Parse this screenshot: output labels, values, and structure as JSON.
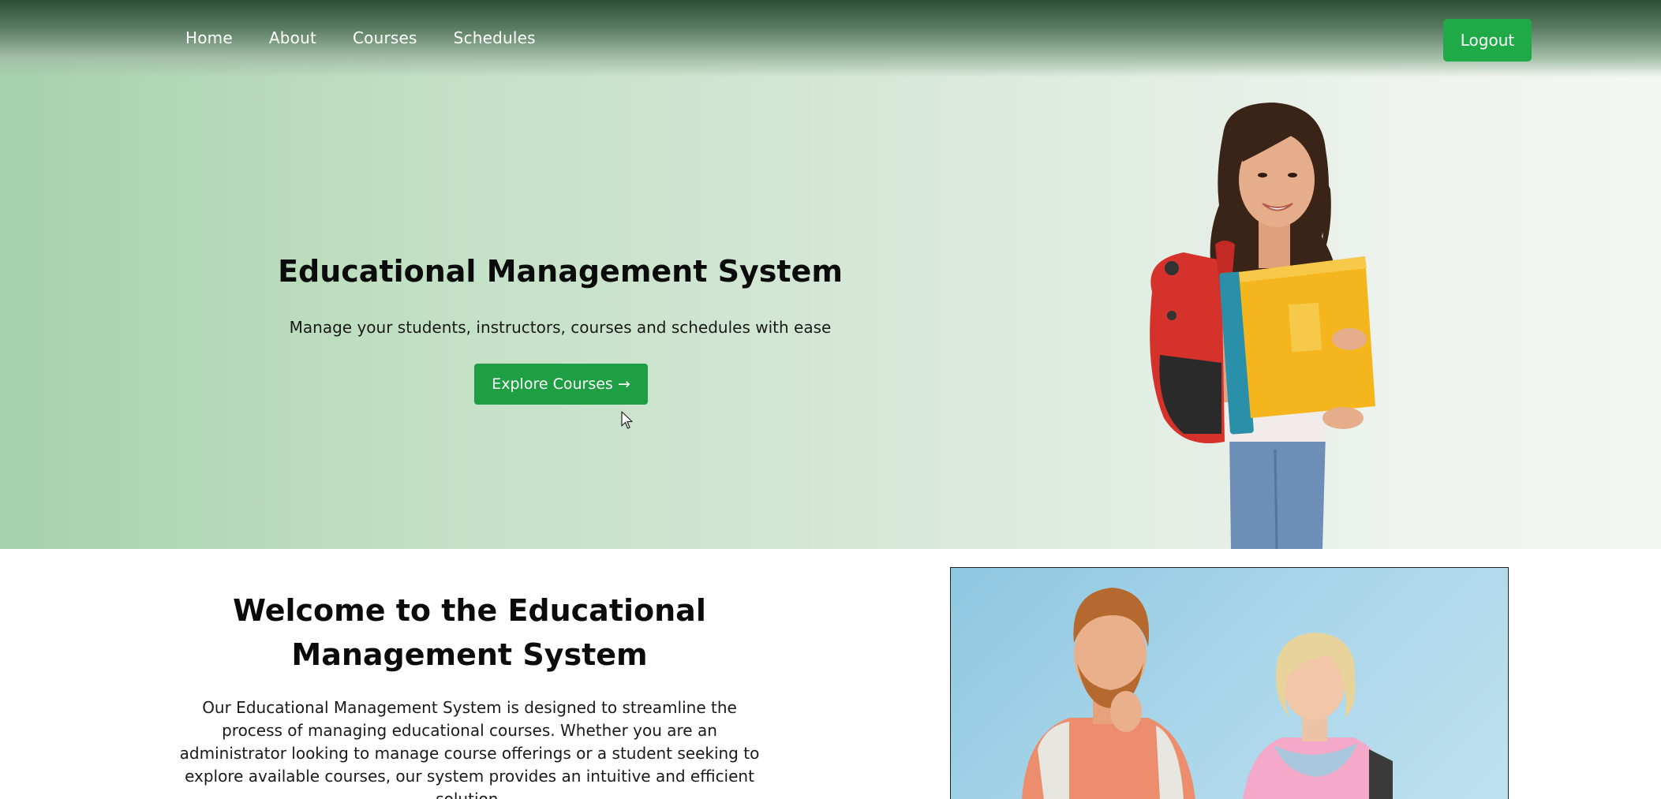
{
  "nav": {
    "links": [
      "Home",
      "About",
      "Courses",
      "Schedules"
    ],
    "logout_label": "Logout"
  },
  "hero": {
    "title": "Educational Management System",
    "subtitle": "Manage your students, instructors, courses and schedules with ease",
    "cta_label": "Explore Courses →"
  },
  "welcome": {
    "title": "Welcome to the Educational Management System",
    "text": "Our Educational Management System is designed to streamline the process of managing educational courses. Whether you are an administrator looking to manage course offerings or a student seeking to explore available courses, our system provides an intuitive and efficient solution."
  },
  "colors": {
    "accent_green": "#1faa47",
    "nav_dark": "#2c4f35",
    "hero_light_green": "#a6d1aa"
  },
  "icons": {
    "cursor": "mouse-pointer-icon"
  }
}
